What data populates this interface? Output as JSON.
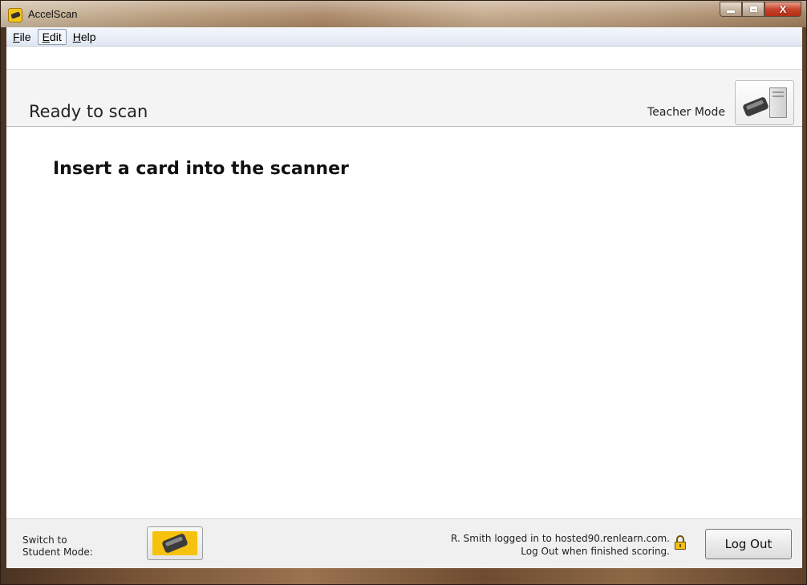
{
  "window": {
    "title": "AccelScan",
    "close_glyph": "X"
  },
  "menu": {
    "items": [
      {
        "pre": "",
        "u": "F",
        "post": "ile"
      },
      {
        "pre": "",
        "u": "E",
        "post": "dit"
      },
      {
        "pre": "",
        "u": "H",
        "post": "elp"
      }
    ]
  },
  "header": {
    "status_title": "Ready to scan",
    "mode_label": "Teacher Mode",
    "mode_icon": "scanner-computer-icon"
  },
  "main": {
    "instruction": "Insert a card into the scanner"
  },
  "footer": {
    "switch_label": "Switch to\nStudent Mode:",
    "student_icon": "scanner-icon",
    "login_line1": "R. Smith logged in to hosted90.renlearn.com.",
    "login_line2": "Log Out when finished scoring.",
    "lock_icon": "lock-icon",
    "logout_label": "Log Out"
  },
  "colors": {
    "accent_yellow": "#f6c20f",
    "menubar": "#dfe7f2",
    "header_bg": "#f4f4f4"
  }
}
